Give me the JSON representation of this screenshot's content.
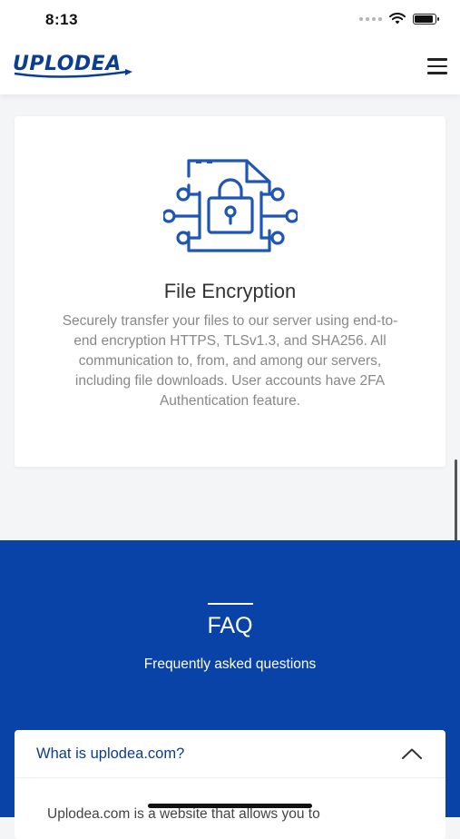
{
  "status_bar": {
    "time": "8:13"
  },
  "header": {
    "logo_text": "UPLODEA",
    "menu_icon": "hamburger-menu-icon"
  },
  "feature": {
    "icon": "file-lock-encryption-icon",
    "title": "File Encryption",
    "description": "Securely transfer your files to our server using end-to-end encryption HTTPS, TLSv1.3, and SHA256. All communication to, from, and among our servers, including file downloads. User accounts have 2FA Authentication feature."
  },
  "faq": {
    "title": "FAQ",
    "subtitle": "Frequently asked questions",
    "items": [
      {
        "question": "What is uplodea.com?",
        "answer": "Uplodea.com is a website that allows you to"
      }
    ]
  },
  "colors": {
    "brand_blue": "#0a43a8",
    "logo_blue": "#0b3d91",
    "text_gray": "#888888"
  }
}
